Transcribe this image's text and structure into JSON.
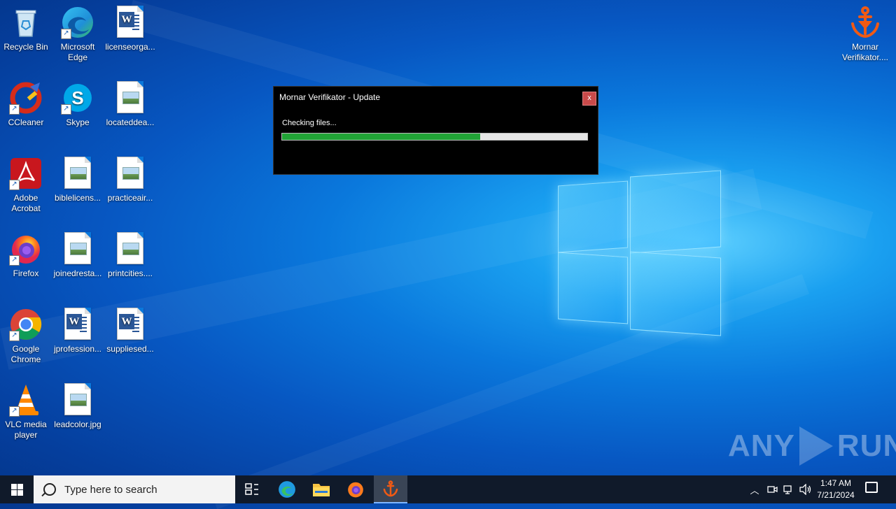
{
  "desktop": {
    "icons": [
      {
        "label": "Recycle Bin"
      },
      {
        "label": "Microsoft Edge"
      },
      {
        "label": "licenseorga..."
      },
      {
        "label": "CCleaner"
      },
      {
        "label": "Skype"
      },
      {
        "label": "locateddea..."
      },
      {
        "label": "Adobe Acrobat"
      },
      {
        "label": "biblelicens..."
      },
      {
        "label": "practiceair..."
      },
      {
        "label": "Firefox"
      },
      {
        "label": "joinedresta..."
      },
      {
        "label": "printcities...."
      },
      {
        "label": "Google Chrome"
      },
      {
        "label": "jprofession..."
      },
      {
        "label": "suppliesed..."
      },
      {
        "label": "VLC media player"
      },
      {
        "label": "leadcolor.jpg"
      },
      {
        "label": "Mornar Verifikator...."
      }
    ]
  },
  "dialog": {
    "title": "Mornar Verifikator - Update",
    "close_label": "x",
    "status": "Checking files...",
    "progress_percent": 65,
    "progress_color": "#21a336"
  },
  "watermark": {
    "text_left": "ANY",
    "text_right": "RUN"
  },
  "taskbar": {
    "search_placeholder": "Type here to search",
    "pinned": [
      "task-view-icon",
      "edge-icon",
      "file-explorer-icon",
      "firefox-icon",
      "mornar-verifikator-icon"
    ],
    "time": "1:47 AM",
    "date": "7/21/2024"
  }
}
